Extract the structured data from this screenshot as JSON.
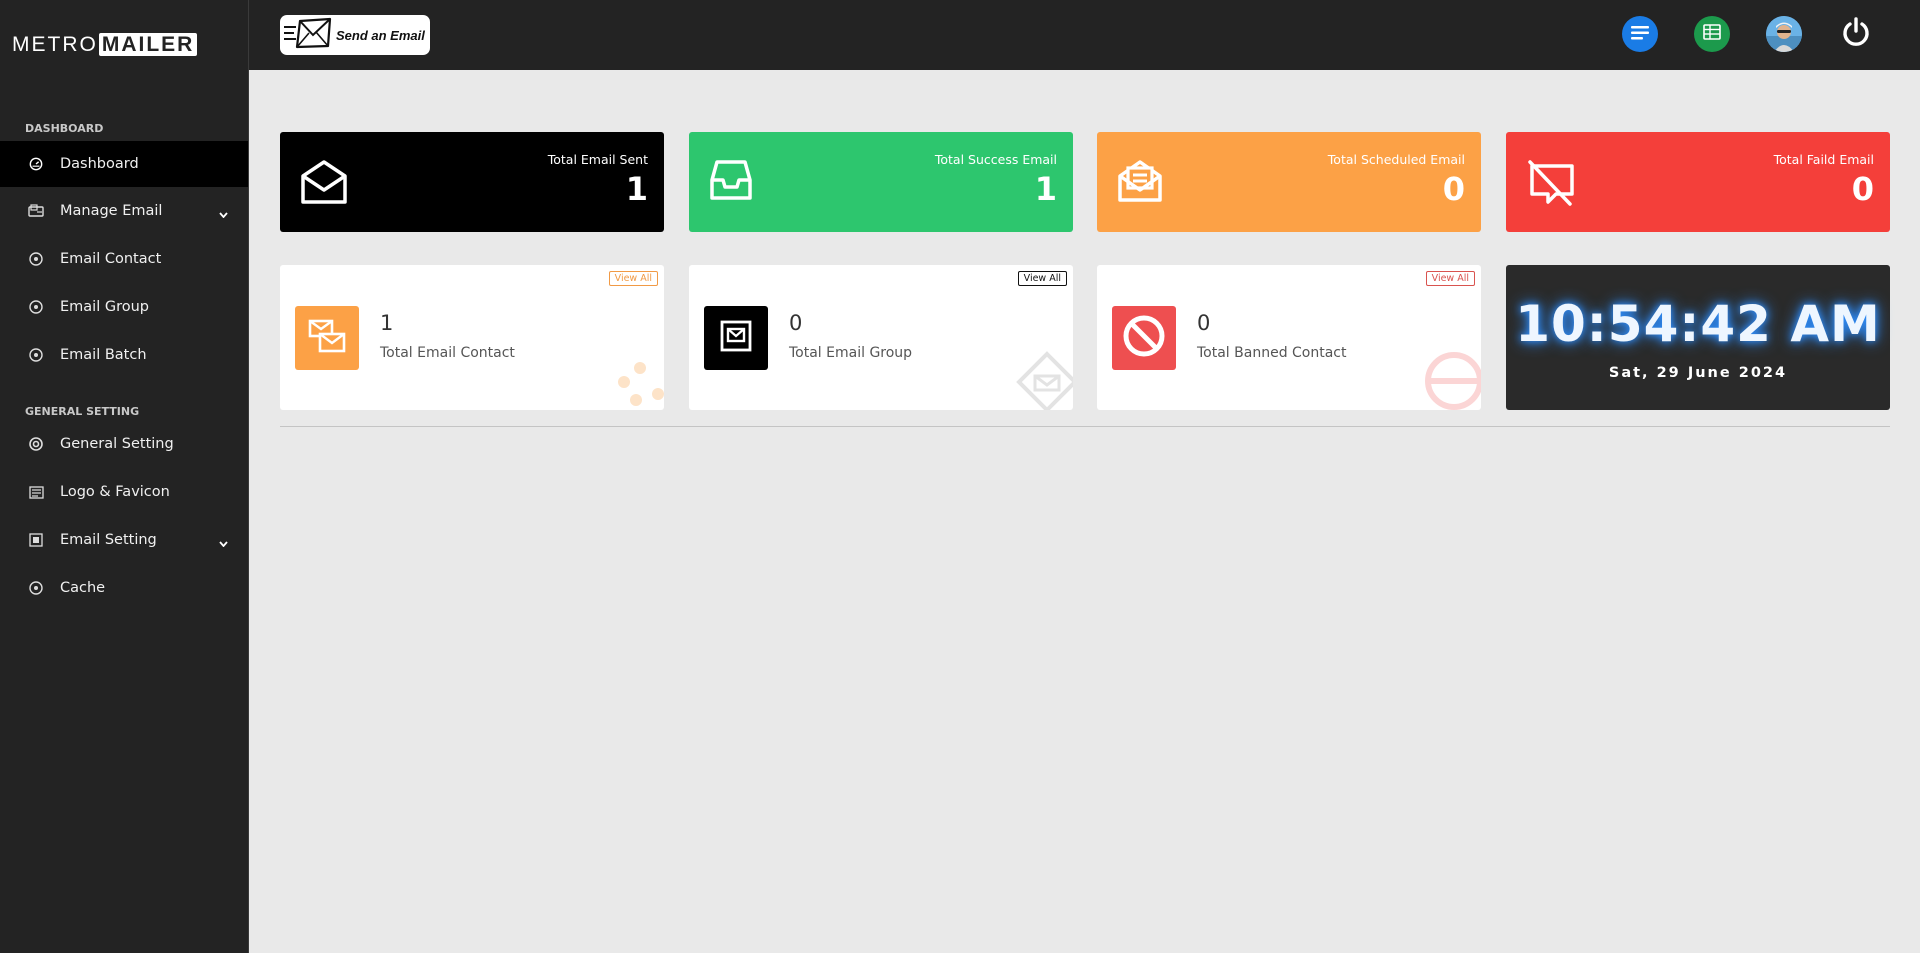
{
  "brand": {
    "logo_left": "METRO",
    "logo_right": "MAILER"
  },
  "topbar": {
    "send_button_label": "Send an Email",
    "icons": [
      "menu-icon",
      "spreadsheet-icon",
      "avatar",
      "power-icon"
    ],
    "colors": {
      "menu": "#1a7ce6",
      "sheet": "#1c9a4c"
    }
  },
  "sidebar": {
    "section_dashboard": "DASHBOARD",
    "section_general": "GENERAL SETTING",
    "items": [
      {
        "label": "Dashboard",
        "icon": "gauge-icon",
        "active": true
      },
      {
        "label": "Manage Email",
        "icon": "mailbox-icon",
        "has_submenu": true
      },
      {
        "label": "Email Contact",
        "icon": "circle-dot-icon"
      },
      {
        "label": "Email Group",
        "icon": "circle-dot-icon"
      },
      {
        "label": "Email Batch",
        "icon": "circle-dot-icon"
      },
      {
        "label": "General Setting",
        "icon": "lifebuoy-icon"
      },
      {
        "label": "Logo & Favicon",
        "icon": "image-icon"
      },
      {
        "label": "Email Setting",
        "icon": "settings-frame-icon",
        "has_submenu": true
      },
      {
        "label": "Cache",
        "icon": "circle-dot-icon"
      }
    ]
  },
  "stats": [
    {
      "title": "Total Email Sent",
      "value": "1",
      "color": "#000000",
      "icon": "envelope-open-icon"
    },
    {
      "title": "Total Success Email",
      "value": "1",
      "color": "#2dc66e",
      "icon": "inbox-icon"
    },
    {
      "title": "Total Scheduled Email",
      "value": "0",
      "color": "#fca146",
      "icon": "envelope-letter-icon"
    },
    {
      "title": "Total Faild Email",
      "value": "0",
      "color": "#f43f3a",
      "icon": "message-off-icon"
    }
  ],
  "info_cards": [
    {
      "count": "1",
      "label": "Total Email Contact",
      "view_all": "View All",
      "color": "#fca146",
      "icon": "mails-icon"
    },
    {
      "count": "0",
      "label": "Total Email Group",
      "view_all": "View All",
      "color": "#000000",
      "icon": "mail-box-icon"
    },
    {
      "count": "0",
      "label": "Total Banned Contact",
      "view_all": "View All",
      "color": "#ee4f50",
      "icon": "ban-icon"
    }
  ],
  "clock": {
    "time": "10:54:42 AM",
    "date": "Sat, 29 June 2024"
  }
}
